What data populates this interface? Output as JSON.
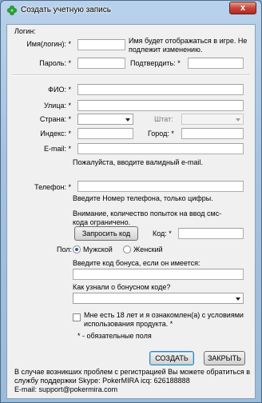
{
  "window": {
    "title": "Создать учетную запись",
    "close_glyph": "x"
  },
  "login": {
    "section_label": "Логин:",
    "name_label": "Имя(логин): *",
    "name_hint": "Имя будет отображаться в игре. Не подлежит изменению.",
    "password_label": "Пароль: *",
    "confirm_label": "Подтвердить: *"
  },
  "personal": {
    "fio_label": "ФИО: *",
    "street_label": "Улица: *",
    "country_label": "Страна: *",
    "state_label": "Штат:",
    "zip_label": "Индекс: *",
    "city_label": "Город: *",
    "email_label": "E-mail: *",
    "email_hint": "Пожалуйста, вводите валидный e-mail."
  },
  "phone": {
    "label": "Телефон: *",
    "hint": "Введите Номер телефона, только цифры.",
    "warning": "Внимание, количество попыток на ввод смс-кода ограничено.",
    "request_button": "Запросить код",
    "code_label": "Код: *"
  },
  "gender": {
    "label": "Пол:",
    "male": "Мужской",
    "female": "Женский",
    "selected": "male"
  },
  "bonus": {
    "label": "Введите код бонуса, если он имеется:",
    "source_label": "Как узнали о бонусном коде?"
  },
  "terms": {
    "checkbox_text": "Мне есть  18 лет и я ознакомлен(а) с условиями использования продукта. *",
    "required_note": "* - обязательные поля"
  },
  "actions": {
    "create": "СОЗДАТЬ",
    "close": "ЗАКРЫТЬ"
  },
  "footer": {
    "support_text": "В случае возникших проблем с регистрацией Вы можете обратиться в службу поддержки Skype: PokerMIRA icq: 626188888",
    "email_text": "E-mail: support@pokermira.com"
  },
  "colors": {
    "accent_icon": "#2e9a3a",
    "close_button": "#c8463a"
  }
}
